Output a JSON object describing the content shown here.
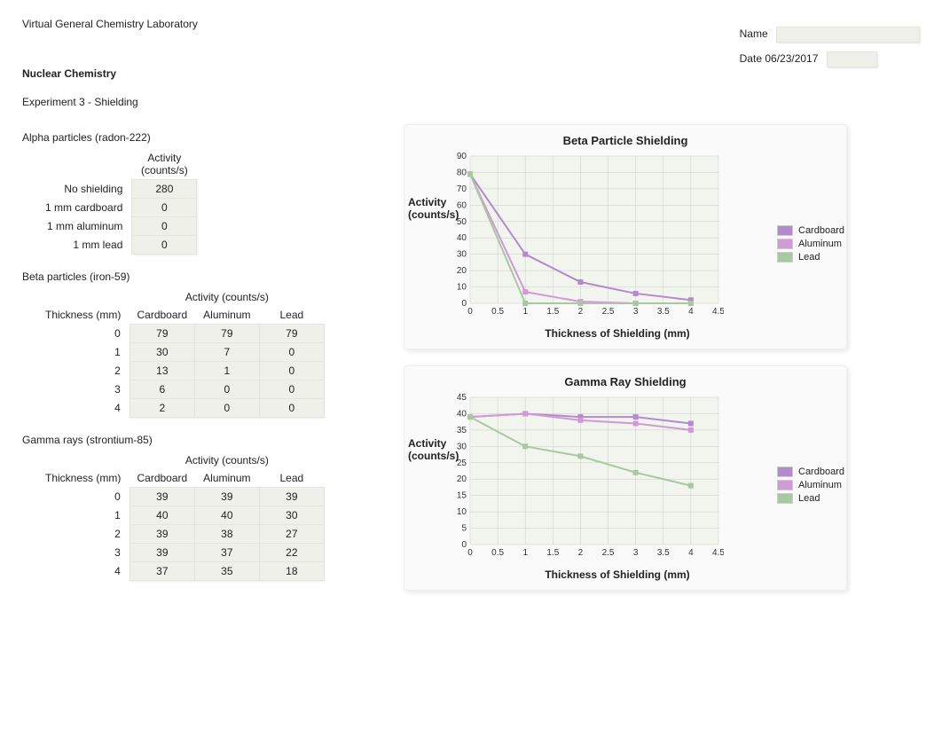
{
  "header": {
    "title": "Virtual General Chemistry Laboratory",
    "subject": "Nuclear Chemistry",
    "experiment": "Experiment 3 - Shielding",
    "name_label": "Name",
    "date_label": "Date",
    "date_value": "06/23/2017"
  },
  "alpha": {
    "section": "Alpha particles (radon-222)",
    "col_header": "Activity (counts/s)",
    "rows": [
      {
        "label": "No shielding",
        "value": "280"
      },
      {
        "label": "1 mm cardboard",
        "value": "0"
      },
      {
        "label": "1 mm aluminum",
        "value": "0"
      },
      {
        "label": "1 mm lead",
        "value": "0"
      }
    ]
  },
  "beta": {
    "section": "Beta particles (iron-59)",
    "group_header": "Activity (counts/s)",
    "thickness_header": "Thickness (mm)",
    "materials": [
      "Cardboard",
      "Aluminum",
      "Lead"
    ],
    "rows": [
      {
        "t": "0",
        "v": [
          "79",
          "79",
          "79"
        ]
      },
      {
        "t": "1",
        "v": [
          "30",
          "7",
          "0"
        ]
      },
      {
        "t": "2",
        "v": [
          "13",
          "1",
          "0"
        ]
      },
      {
        "t": "3",
        "v": [
          "6",
          "0",
          "0"
        ]
      },
      {
        "t": "4",
        "v": [
          "2",
          "0",
          "0"
        ]
      }
    ]
  },
  "gamma": {
    "section": "Gamma rays (strontium-85)",
    "group_header": "Activity (counts/s)",
    "thickness_header": "Thickness (mm)",
    "materials": [
      "Cardboard",
      "Aluminum",
      "Lead"
    ],
    "rows": [
      {
        "t": "0",
        "v": [
          "39",
          "39",
          "39"
        ]
      },
      {
        "t": "1",
        "v": [
          "40",
          "40",
          "30"
        ]
      },
      {
        "t": "2",
        "v": [
          "39",
          "38",
          "27"
        ]
      },
      {
        "t": "3",
        "v": [
          "39",
          "37",
          "22"
        ]
      },
      {
        "t": "4",
        "v": [
          "37",
          "35",
          "18"
        ]
      }
    ]
  },
  "chart_data": [
    {
      "type": "line",
      "title": "Beta Particle Shielding",
      "xlabel": "Thickness of Shielding (mm)",
      "ylabel": "Activity (counts/s)",
      "xlim": [
        0,
        4.5
      ],
      "ylim": [
        0,
        90
      ],
      "xticks": [
        0,
        0.5,
        1,
        1.5,
        2,
        2.5,
        3,
        3.5,
        4,
        4.5
      ],
      "yticks": [
        0,
        10,
        20,
        30,
        40,
        50,
        60,
        70,
        80,
        90
      ],
      "x": [
        0,
        1,
        2,
        3,
        4
      ],
      "series": [
        {
          "name": "Cardboard",
          "color": "#b38acb",
          "values": [
            79,
            30,
            13,
            6,
            2
          ]
        },
        {
          "name": "Aluminum",
          "color": "#d199d6",
          "values": [
            79,
            7,
            1,
            0,
            0
          ]
        },
        {
          "name": "Lead",
          "color": "#a9c8a1",
          "values": [
            79,
            0,
            0,
            0,
            0
          ]
        }
      ],
      "legend": [
        "Cardboard",
        "Aluminum",
        "Lead"
      ]
    },
    {
      "type": "line",
      "title": "Gamma Ray Shielding",
      "xlabel": "Thickness of Shielding (mm)",
      "ylabel": "Activity (counts/s)",
      "xlim": [
        0,
        4.5
      ],
      "ylim": [
        0,
        45
      ],
      "xticks": [
        0,
        0.5,
        1,
        1.5,
        2,
        2.5,
        3,
        3.5,
        4,
        4.5
      ],
      "yticks": [
        0,
        5,
        10,
        15,
        20,
        25,
        30,
        35,
        40,
        45
      ],
      "x": [
        0,
        1,
        2,
        3,
        4
      ],
      "series": [
        {
          "name": "Cardboard",
          "color": "#b38acb",
          "values": [
            39,
            40,
            39,
            39,
            37
          ]
        },
        {
          "name": "Aluminum",
          "color": "#d199d6",
          "values": [
            39,
            40,
            38,
            37,
            35
          ]
        },
        {
          "name": "Lead",
          "color": "#a9c8a1",
          "values": [
            39,
            30,
            27,
            22,
            18
          ]
        }
      ],
      "legend": [
        "Cardboard",
        "Aluminum",
        "Lead"
      ]
    }
  ]
}
